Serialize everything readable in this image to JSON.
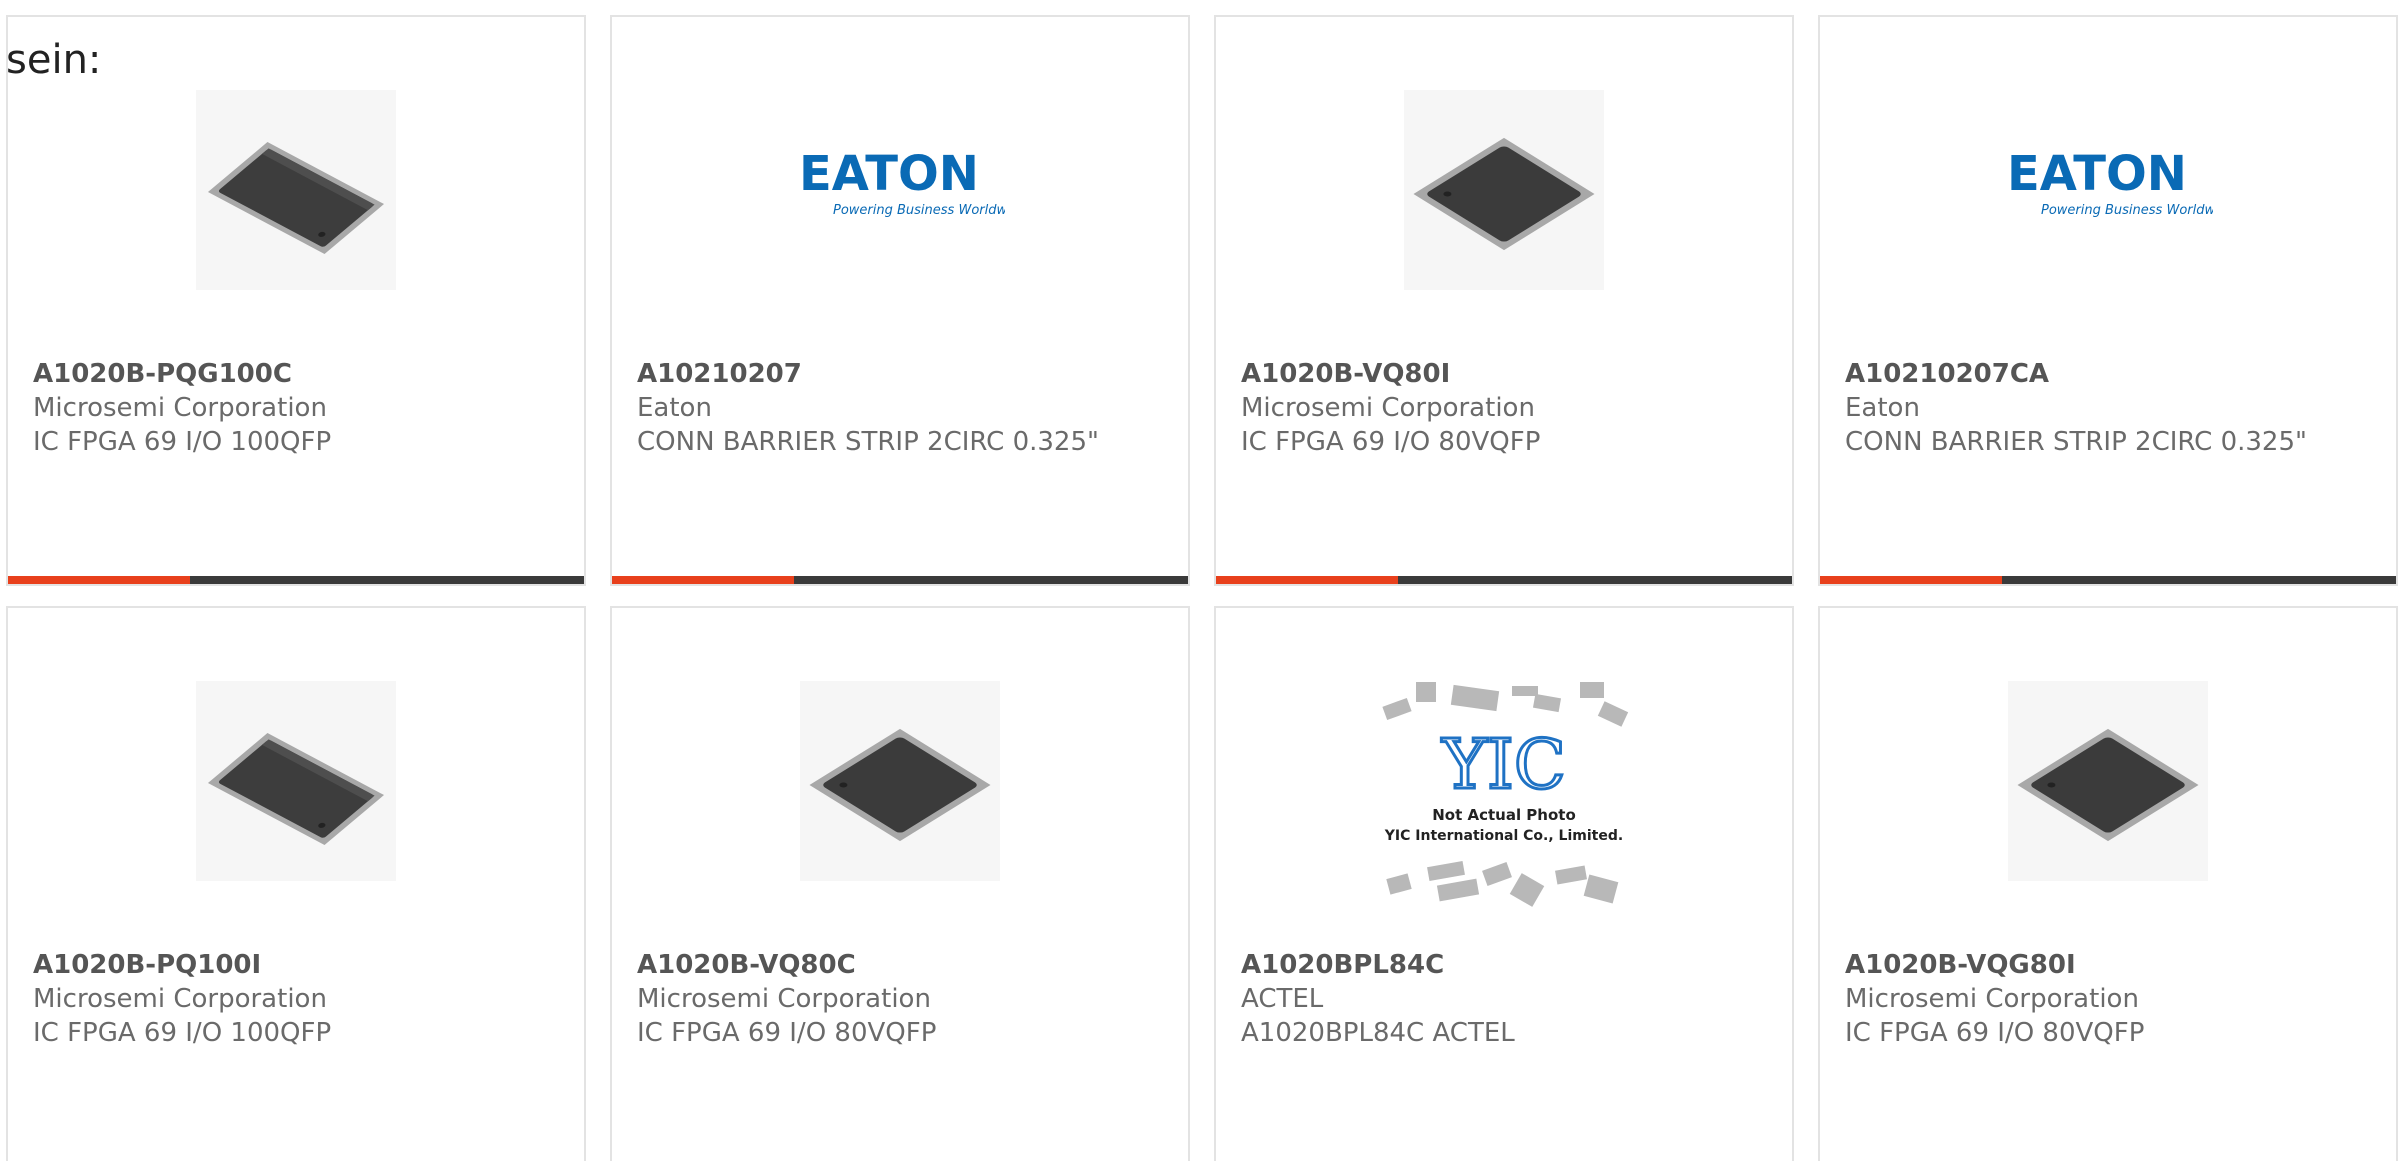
{
  "page": {
    "intro_text": "sein:"
  },
  "colors": {
    "accent": "#e8401c",
    "bar_dark": "#3a3a3a",
    "eaton_blue": "#0a6ab5",
    "chip_dark": "#3b3b3b"
  },
  "products": [
    {
      "part": "A1020B-PQG100C",
      "maker": "Microsemi Corporation",
      "desc": "IC FPGA 69 I/O 100QFP",
      "image": "qfp-chip-tilted-icon"
    },
    {
      "part": "A10210207",
      "maker": "Eaton",
      "desc": "CONN BARRIER STRIP 2CIRC 0.325\"",
      "image": "eaton-logo"
    },
    {
      "part": "A1020B-VQ80I",
      "maker": "Microsemi Corporation",
      "desc": "IC FPGA 69 I/O 80VQFP",
      "image": "vqfp-chip-icon"
    },
    {
      "part": "A10210207CA",
      "maker": "Eaton",
      "desc": "CONN BARRIER STRIP 2CIRC 0.325\"",
      "image": "eaton-logo"
    },
    {
      "part": "A1020B-PQ100I",
      "maker": "Microsemi Corporation",
      "desc": "IC FPGA 69 I/O 100QFP",
      "image": "qfp-chip-tilted-icon"
    },
    {
      "part": "A1020B-VQ80C",
      "maker": "Microsemi Corporation",
      "desc": "IC FPGA 69 I/O 80VQFP",
      "image": "vqfp-chip-icon"
    },
    {
      "part": "A1020BPL84C",
      "maker": "ACTEL",
      "desc": "A1020BPL84C ACTEL",
      "image": "yic-placeholder"
    },
    {
      "part": "A1020B-VQG80I",
      "maker": "Microsemi Corporation",
      "desc": "IC FPGA 69 I/O 80VQFP",
      "image": "vqfp-chip-icon"
    }
  ],
  "eaton_logo": {
    "wordmark": "EATON",
    "tagline": "Powering Business Worldwide"
  },
  "yic_placeholder": {
    "brand": "YIC",
    "line1": "Not Actual Photo",
    "line2": "YIC International Co., Limited."
  }
}
